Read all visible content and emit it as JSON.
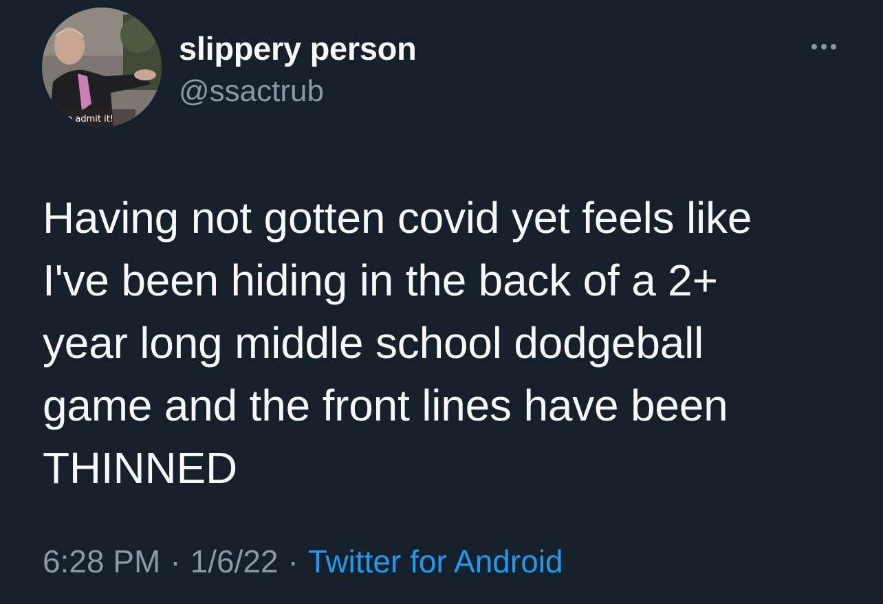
{
  "author": {
    "display_name": "slippery person",
    "handle": "@ssactrub",
    "avatar_caption": "he admit it!"
  },
  "tweet": {
    "lines": [
      "Having not gotten covid yet feels like",
      "I've been hiding in the back of a 2+",
      "year long middle school dodgeball",
      "game and the front lines have been",
      "THINNED"
    ]
  },
  "meta": {
    "time": "6:28 PM",
    "date": "1/6/22",
    "source": "Twitter for Android",
    "separator": "·"
  },
  "icons": {
    "more": "more-horizontal-icon"
  },
  "colors": {
    "background": "#16202b",
    "primary_text": "#f7f9f9",
    "secondary_text": "#8b98a5",
    "link": "#1d9bf0"
  }
}
